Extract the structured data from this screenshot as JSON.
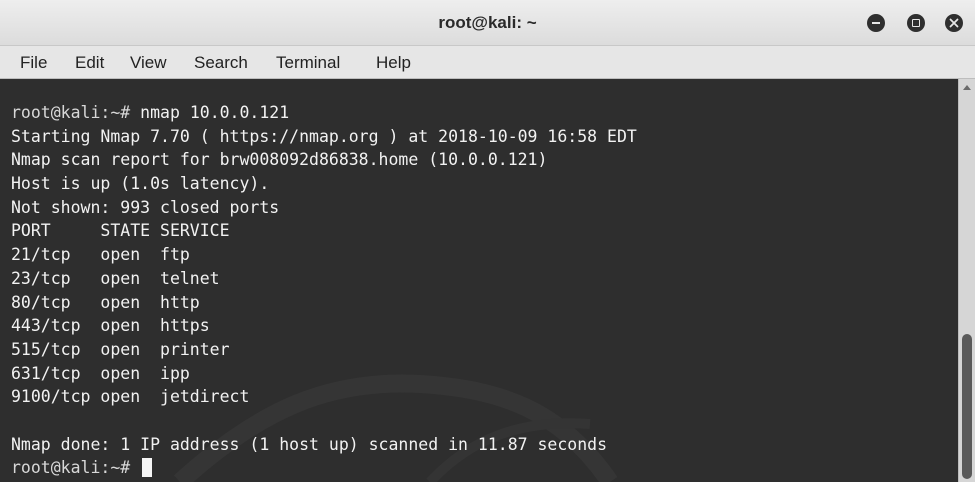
{
  "window": {
    "title": "root@kali: ~"
  },
  "menu": {
    "items": [
      "File",
      "Edit",
      "View",
      "Search",
      "Terminal",
      "Help"
    ]
  },
  "terminal": {
    "prompt": "root@kali:~#",
    "lines": [
      {
        "prompt": "root@kali:~#",
        "text": " nmap 10.0.0.121"
      },
      {
        "prompt": "",
        "text": "Starting Nmap 7.70 ( https://nmap.org ) at 2018-10-09 16:58 EDT"
      },
      {
        "prompt": "",
        "text": "Nmap scan report for brw008092d86838.home (10.0.0.121)"
      },
      {
        "prompt": "",
        "text": "Host is up (1.0s latency)."
      },
      {
        "prompt": "",
        "text": "Not shown: 993 closed ports"
      },
      {
        "prompt": "",
        "text": "PORT     STATE SERVICE"
      },
      {
        "prompt": "",
        "text": "21/tcp   open  ftp"
      },
      {
        "prompt": "",
        "text": "23/tcp   open  telnet"
      },
      {
        "prompt": "",
        "text": "80/tcp   open  http"
      },
      {
        "prompt": "",
        "text": "443/tcp  open  https"
      },
      {
        "prompt": "",
        "text": "515/tcp  open  printer"
      },
      {
        "prompt": "",
        "text": "631/tcp  open  ipp"
      },
      {
        "prompt": "",
        "text": "9100/tcp open  jetdirect"
      },
      {
        "prompt": "",
        "text": ""
      },
      {
        "prompt": "",
        "text": "Nmap done: 1 IP address (1 host up) scanned in 11.87 seconds"
      },
      {
        "prompt": "root@kali:~#",
        "text": " "
      }
    ]
  },
  "colors": {
    "terminal_bg": "#2e2e2e",
    "terminal_fg": "#f2f2f2",
    "titlebar_bg": "#e4e4e4",
    "menubar_bg": "#e6e6e6"
  },
  "icons": {
    "minimize": "minimize-icon",
    "maximize": "maximize-icon",
    "close": "close-icon"
  }
}
